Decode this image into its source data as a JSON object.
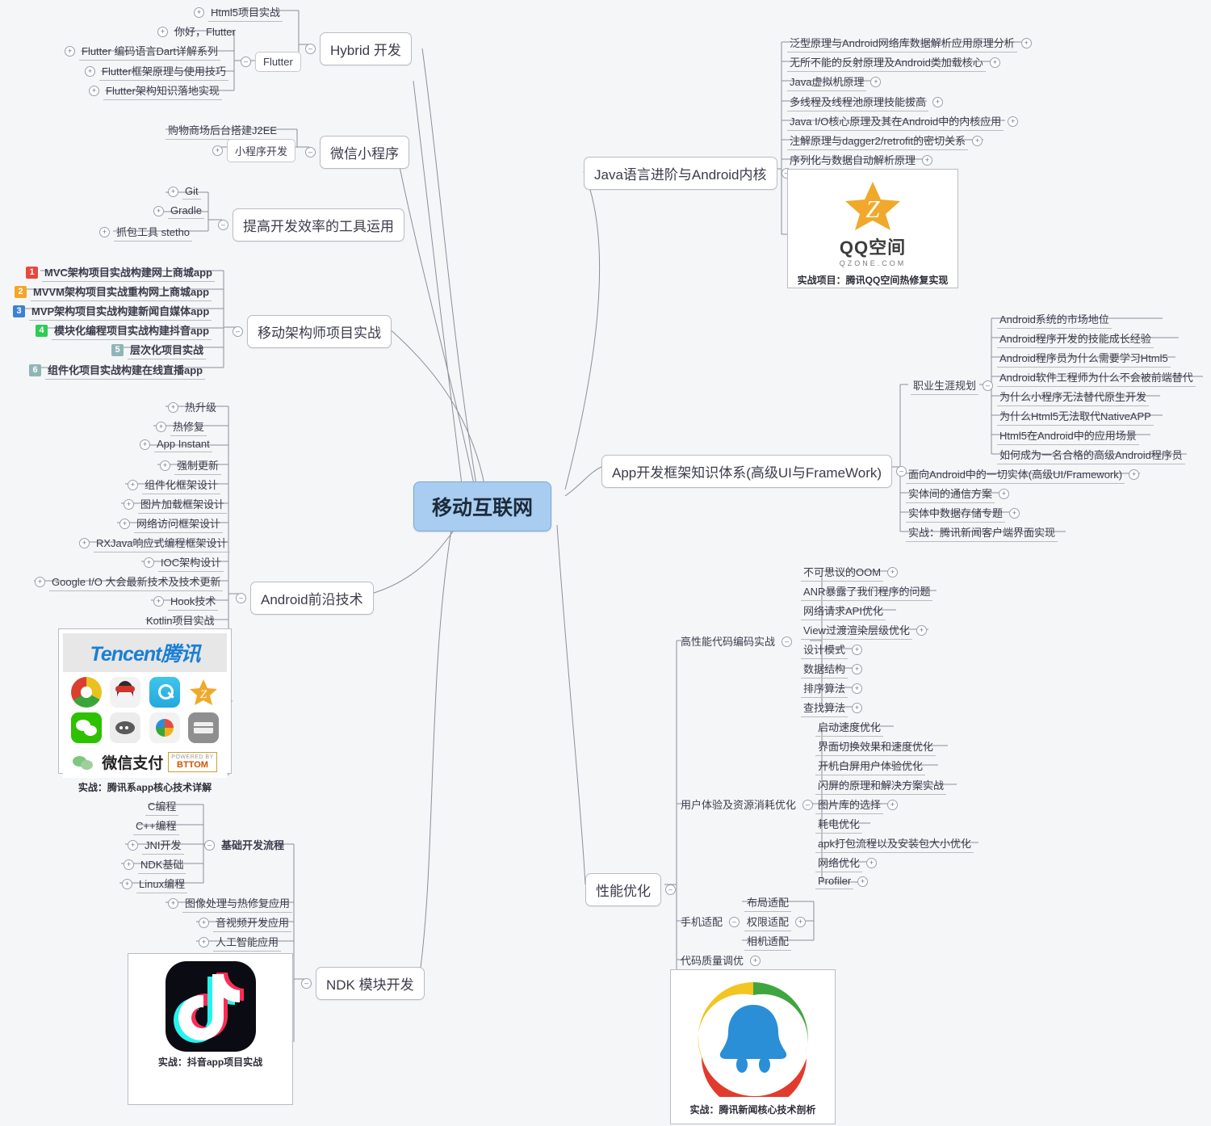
{
  "root": {
    "label": "移动互联网"
  },
  "branches": {
    "hybrid": {
      "label": "Hybrid 开发",
      "children": [
        {
          "label": "Html5项目实战",
          "toggle": "plus"
        },
        {
          "label": "Flutter",
          "toggle": "minus",
          "children": [
            {
              "label": "你好，Flutter",
              "toggle": "plus"
            },
            {
              "label": "Flutter 编码语言Dart详解系列",
              "toggle": "plus"
            },
            {
              "label": "Flutter框架原理与使用技巧",
              "toggle": "plus"
            },
            {
              "label": "Flutter架构知识落地实现",
              "toggle": "plus"
            }
          ]
        }
      ]
    },
    "wechat_mini": {
      "label": "微信小程序",
      "children": [
        {
          "label": "购物商场后台搭建J2EE",
          "toggle": "none"
        },
        {
          "label": "小程序开发",
          "toggle": "plus"
        }
      ]
    },
    "tools": {
      "label": "提高开发效率的工具运用",
      "children": [
        {
          "label": "Git",
          "toggle": "plus"
        },
        {
          "label": "Gradle",
          "toggle": "plus"
        },
        {
          "label": "抓包工具 stetho",
          "toggle": "plus"
        }
      ]
    },
    "architect_projects": {
      "label": "移动架构师项目实战",
      "children": [
        {
          "num": "1",
          "color": "#e8483c",
          "label": "MVC架构项目实战构建网上商城app"
        },
        {
          "num": "2",
          "color": "#f5a623",
          "label": "MVVM架构项目实战重构网上商城app"
        },
        {
          "num": "3",
          "color": "#3b82d6",
          "label": "MVP架构项目实战构建新闻自媒体app"
        },
        {
          "num": "4",
          "color": "#2ecc55",
          "label": "模块化编程项目实战构建抖音app"
        },
        {
          "num": "5",
          "color": "#8fb6b6",
          "label": "层次化项目实战"
        },
        {
          "num": "6",
          "color": "#8fb6b6",
          "label": "组件化项目实战构建在线直播app"
        }
      ]
    },
    "android_frontier": {
      "label": "Android前沿技术",
      "children": [
        {
          "label": "热升级",
          "toggle": "plus"
        },
        {
          "label": "热修复",
          "toggle": "plus"
        },
        {
          "label": "App Instant",
          "toggle": "plus"
        },
        {
          "label": "强制更新",
          "toggle": "plus"
        },
        {
          "label": "组件化框架设计",
          "toggle": "plus"
        },
        {
          "label": "图片加载框架设计",
          "toggle": "plus"
        },
        {
          "label": "网络访问框架设计",
          "toggle": "plus"
        },
        {
          "label": "RXJava响应式编程框架设计",
          "toggle": "plus"
        },
        {
          "label": "IOC架构设计",
          "toggle": "plus"
        },
        {
          "label": "Google I/O 大会最新技术及技术更新",
          "toggle": "plus"
        },
        {
          "label": "Hook技术",
          "toggle": "plus"
        },
        {
          "label": "Kotlin项目实战",
          "toggle": "none"
        }
      ],
      "image_card": {
        "logo_text": "Tencent",
        "logo_cn": "腾讯",
        "wxpay": "微信支付",
        "powered": "POWERED BY",
        "powered_brand": "BTTOM",
        "caption": "实战：腾讯系app核心技术详解"
      }
    },
    "ndk": {
      "label": "NDK 模块开发",
      "children": [
        {
          "label": "基础开发流程",
          "toggle": "minus",
          "children": [
            {
              "label": "C编程",
              "toggle": "none"
            },
            {
              "label": "C++编程",
              "toggle": "none"
            },
            {
              "label": "JNI开发",
              "toggle": "plus"
            },
            {
              "label": "NDK基础",
              "toggle": "plus"
            },
            {
              "label": "Linux编程",
              "toggle": "plus"
            }
          ]
        },
        {
          "label": "图像处理与热修复应用",
          "toggle": "plus"
        },
        {
          "label": "音视频开发应用",
          "toggle": "plus"
        },
        {
          "label": "人工智能应用",
          "toggle": "plus"
        }
      ],
      "image_card": {
        "caption": "实战：抖音app项目实战"
      }
    },
    "java_core": {
      "label": "Java语言进阶与Android内核",
      "children": [
        {
          "label": "泛型原理与Android网络库数据解析应用原理分析",
          "toggle": "plus"
        },
        {
          "label": "无所不能的反射原理及Android类加载核心",
          "toggle": "plus"
        },
        {
          "label": "Java虚拟机原理",
          "toggle": "plus"
        },
        {
          "label": "多线程及线程池原理技能拔高",
          "toggle": "plus"
        },
        {
          "label": "Java I/O核心原理及其在Android中的内核应用",
          "toggle": "plus"
        },
        {
          "label": "注解原理与dagger2/retrofit的密切关系",
          "toggle": "plus"
        },
        {
          "label": "序列化与数据自动解析原理",
          "toggle": "plus"
        }
      ],
      "image_card": {
        "title": "QQ空间",
        "subtitle": "QZONE.COM",
        "caption": "实战项目：腾讯QQ空间热修复实现"
      }
    },
    "app_framework": {
      "label": "App开发框架知识体系(高级UI与FrameWork)",
      "children": [
        {
          "label": "职业生涯规划",
          "toggle": "minus",
          "children": [
            {
              "label": "Android系统的市场地位",
              "toggle": "none"
            },
            {
              "label": "Android程序开发的技能成长经验",
              "toggle": "none"
            },
            {
              "label": "Android程序员为什么需要学习Html5",
              "toggle": "none"
            },
            {
              "label": "Android软件工程师为什么不会被前端替代",
              "toggle": "none"
            },
            {
              "label": "为什么小程序无法替代原生开发",
              "toggle": "none"
            },
            {
              "label": "为什么Html5无法取代NativeAPP",
              "toggle": "none"
            },
            {
              "label": "Html5在Android中的应用场景",
              "toggle": "none"
            },
            {
              "label": "如何成为一名合格的高级Android程序员",
              "toggle": "none"
            }
          ]
        },
        {
          "label": "面向Android中的一切实体(高级UI/Framework)",
          "toggle": "plus"
        },
        {
          "label": "实体间的通信方案",
          "toggle": "plus"
        },
        {
          "label": "实体中数据存储专题",
          "toggle": "plus"
        },
        {
          "label": "实战：腾讯新闻客户端界面实现",
          "toggle": "none"
        }
      ]
    },
    "performance": {
      "label": "性能优化",
      "children": [
        {
          "label": "高性能代码编码实战",
          "toggle": "minus",
          "children": [
            {
              "label": "不可思议的OOM",
              "toggle": "plus"
            },
            {
              "label": "ANR暴露了我们程序的问题",
              "toggle": "none"
            },
            {
              "label": "网络请求API优化",
              "toggle": "none"
            },
            {
              "label": "View过渡渲染层级优化",
              "toggle": "plus"
            },
            {
              "label": "设计模式",
              "toggle": "plus"
            },
            {
              "label": "数据结构",
              "toggle": "plus"
            },
            {
              "label": "排序算法",
              "toggle": "plus"
            },
            {
              "label": "查找算法",
              "toggle": "plus"
            }
          ]
        },
        {
          "label": "用户体验及资源消耗优化",
          "toggle": "minus",
          "children": [
            {
              "label": "启动速度优化",
              "toggle": "none"
            },
            {
              "label": "界面切换效果和速度优化",
              "toggle": "none"
            },
            {
              "label": "开机白屏用户体验优化",
              "toggle": "none"
            },
            {
              "label": "闪屏的原理和解决方案实战",
              "toggle": "none"
            },
            {
              "label": "图片库的选择",
              "toggle": "plus"
            },
            {
              "label": "耗电优化",
              "toggle": "none"
            },
            {
              "label": "apk打包流程以及安装包大小优化",
              "toggle": "none"
            },
            {
              "label": "网络优化",
              "toggle": "plus"
            },
            {
              "label": "Profiler",
              "toggle": "plus"
            }
          ]
        },
        {
          "label": "手机适配",
          "toggle": "minus",
          "children": [
            {
              "label": "布局适配",
              "toggle": "none"
            },
            {
              "label": "权限适配",
              "toggle": "plus"
            },
            {
              "label": "相机适配",
              "toggle": "none"
            }
          ]
        },
        {
          "label": "代码质量调优",
          "toggle": "plus"
        }
      ],
      "image_card": {
        "caption": "实战：腾讯新闻核心技术剖析"
      }
    }
  },
  "colors": {
    "root_fill": "#a8cdf0",
    "root_border": "#7aa9d6",
    "node_border": "#b9bcc4",
    "background": "#f5f6f8",
    "link": "#8b8f9a"
  }
}
